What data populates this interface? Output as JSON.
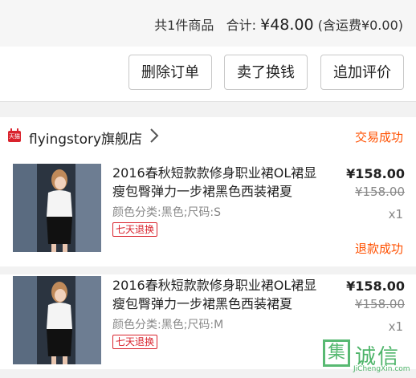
{
  "summary": {
    "count_text": "共1件商品",
    "total_label": "合计:",
    "total_price": "¥48.00",
    "shipping_text": "(含运费¥0.00)"
  },
  "actions": {
    "delete_label": "删除订单",
    "sell_label": "卖了换钱",
    "review_label": "追加评价"
  },
  "shop": {
    "icon_text": "天猫",
    "name": "flyingstory旗舰店",
    "status": "交易成功"
  },
  "items": [
    {
      "title": "2016春秋短款款修身职业裙OL裙显瘦包臀弹力一步裙黑色西装裙夏",
      "sku": "颜色分类:黑色;尺码:S",
      "badge": "七天退换",
      "price_now": "¥158.00",
      "price_old": "¥158.00",
      "qty": "x1",
      "status": ""
    },
    {
      "title": "2016春秋短款款修身职业裙OL裙显瘦包臀弹力一步裙黑色西装裙夏",
      "sku": "颜色分类:黑色;尺码:M",
      "badge": "七天退换",
      "price_now": "¥158.00",
      "price_old": "¥158.00",
      "qty": "x1",
      "status": "退款成功"
    }
  ],
  "watermark": {
    "logo_char": "集",
    "text": "诚信",
    "site": "JiChengXin.com"
  },
  "colors": {
    "accent": "#ff5000",
    "brand_red": "#d9232d",
    "watermark": "#2fa84f"
  }
}
